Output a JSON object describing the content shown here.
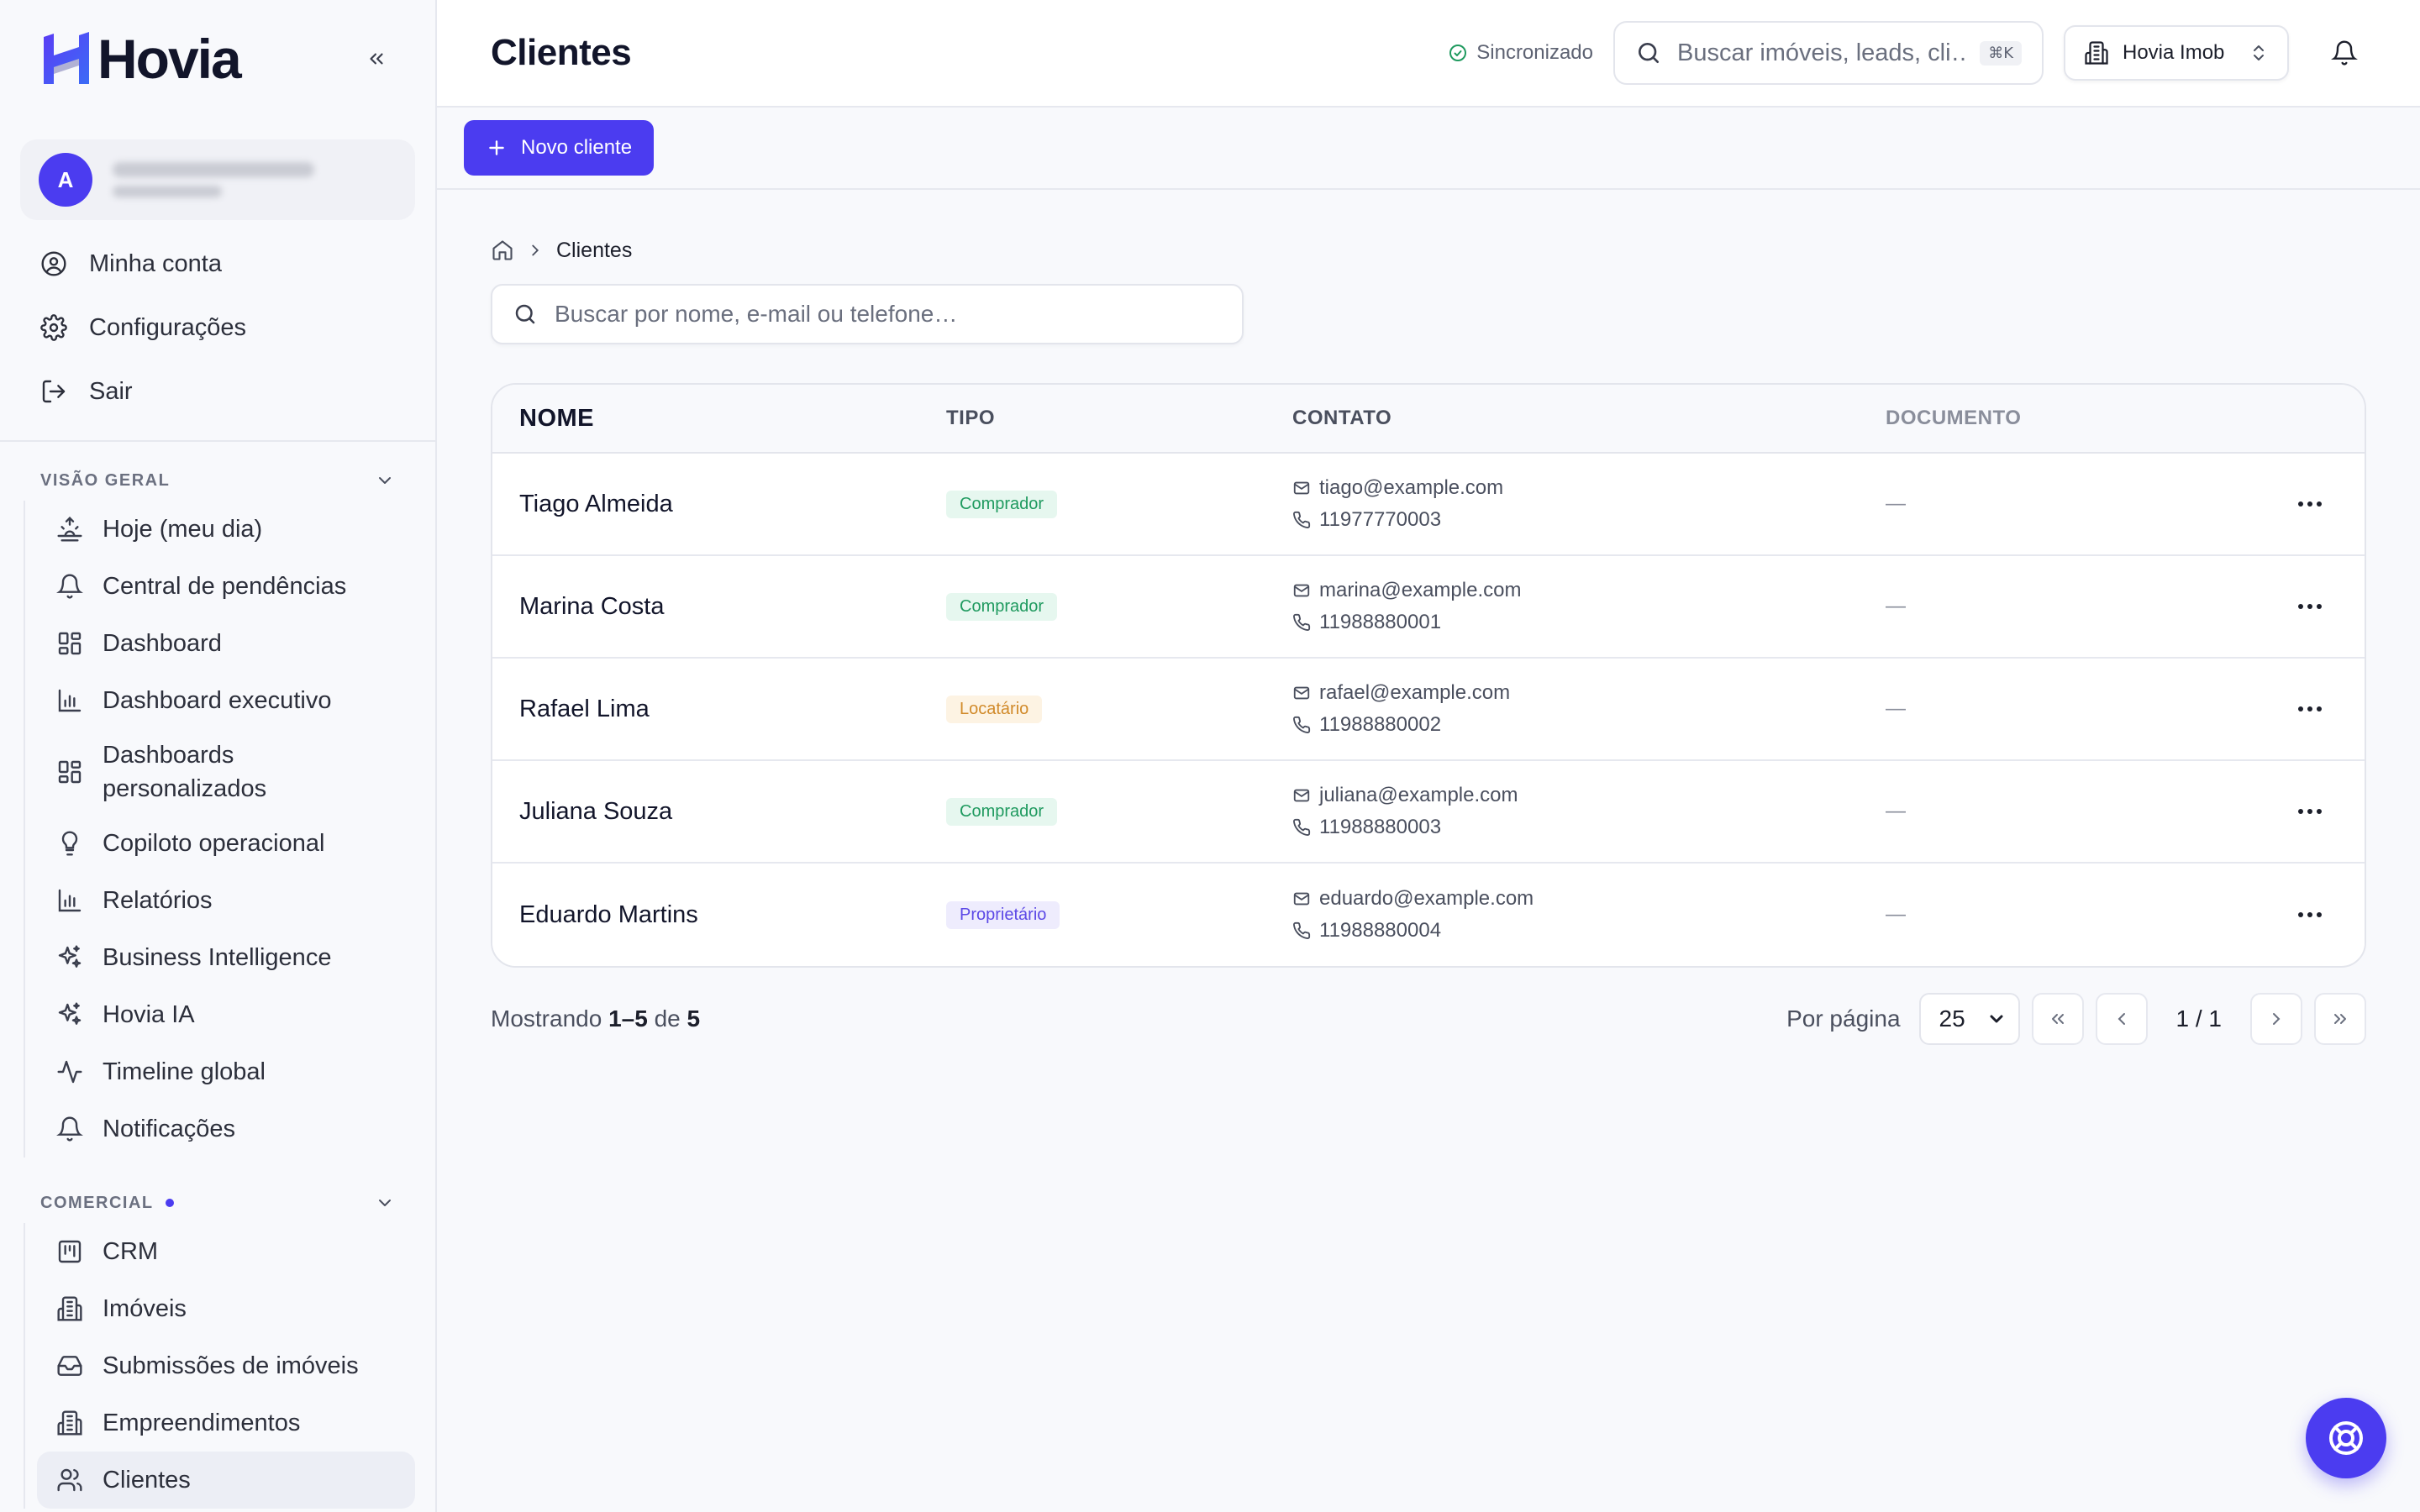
{
  "app": {
    "name": "Hovia",
    "page_title": "Clientes"
  },
  "colors": {
    "accent": "#4b3cf0",
    "success": "#1f9a5f",
    "warning": "#d18a2a"
  },
  "user": {
    "avatar_initial": "A"
  },
  "account_menu": [
    {
      "label": "Minha conta",
      "icon": "user-circle-icon"
    },
    {
      "label": "Configurações",
      "icon": "gear-icon"
    },
    {
      "label": "Sair",
      "icon": "logout-icon"
    }
  ],
  "sections": {
    "overview": {
      "title": "VISÃO GERAL",
      "items": [
        {
          "label": "Hoje (meu dia)",
          "icon": "sunrise-icon"
        },
        {
          "label": "Central de pendências",
          "icon": "bell-icon"
        },
        {
          "label": "Dashboard",
          "icon": "grid-icon"
        },
        {
          "label": "Dashboard executivo",
          "icon": "bar-chart-icon"
        },
        {
          "label": "Dashboards personalizados",
          "icon": "grid-icon"
        },
        {
          "label": "Copiloto operacional",
          "icon": "lightbulb-icon"
        },
        {
          "label": "Relatórios",
          "icon": "bar-chart-icon"
        },
        {
          "label": "Business Intelligence",
          "icon": "sparkles-icon"
        },
        {
          "label": "Hovia IA",
          "icon": "sparkles-icon"
        },
        {
          "label": "Timeline global",
          "icon": "activity-icon"
        },
        {
          "label": "Notificações",
          "icon": "bell-icon"
        }
      ]
    },
    "commercial": {
      "title": "COMERCIAL",
      "items": [
        {
          "label": "CRM",
          "icon": "kanban-icon"
        },
        {
          "label": "Imóveis",
          "icon": "building-icon"
        },
        {
          "label": "Submissões de imóveis",
          "icon": "inbox-icon"
        },
        {
          "label": "Empreendimentos",
          "icon": "building-icon"
        },
        {
          "label": "Clientes",
          "icon": "users-icon"
        }
      ]
    }
  },
  "topbar": {
    "sync_status": "Sincronizado",
    "search_placeholder": "Buscar imóveis, leads, cli…",
    "shortcut": "⌘K",
    "org_name": "Hovia Imob"
  },
  "actions": {
    "new_client": "Novo cliente"
  },
  "breadcrumb": {
    "current": "Clientes"
  },
  "list_search_placeholder": "Buscar por nome, e-mail ou telefone…",
  "table": {
    "columns": {
      "name": "NOME",
      "type": "TIPO",
      "contact": "CONTATO",
      "document": "DOCUMENTO"
    },
    "rows": [
      {
        "name": "Tiago Almeida",
        "type": "Comprador",
        "email": "tiago@example.com",
        "phone": "11977770003",
        "document": "—"
      },
      {
        "name": "Marina Costa",
        "type": "Comprador",
        "email": "marina@example.com",
        "phone": "11988880001",
        "document": "—"
      },
      {
        "name": "Rafael Lima",
        "type": "Locatário",
        "email": "rafael@example.com",
        "phone": "11988880002",
        "document": "—"
      },
      {
        "name": "Juliana Souza",
        "type": "Comprador",
        "email": "juliana@example.com",
        "phone": "11988880003",
        "document": "—"
      },
      {
        "name": "Eduardo Martins",
        "type": "Proprietário",
        "email": "eduardo@example.com",
        "phone": "11988880004",
        "document": "—"
      }
    ]
  },
  "pagination": {
    "showing_prefix": "Mostrando",
    "range": "1–5",
    "of_label": "de",
    "total": "5",
    "per_page_label": "Por página",
    "per_page": "25",
    "page_indicator": "1 / 1"
  }
}
